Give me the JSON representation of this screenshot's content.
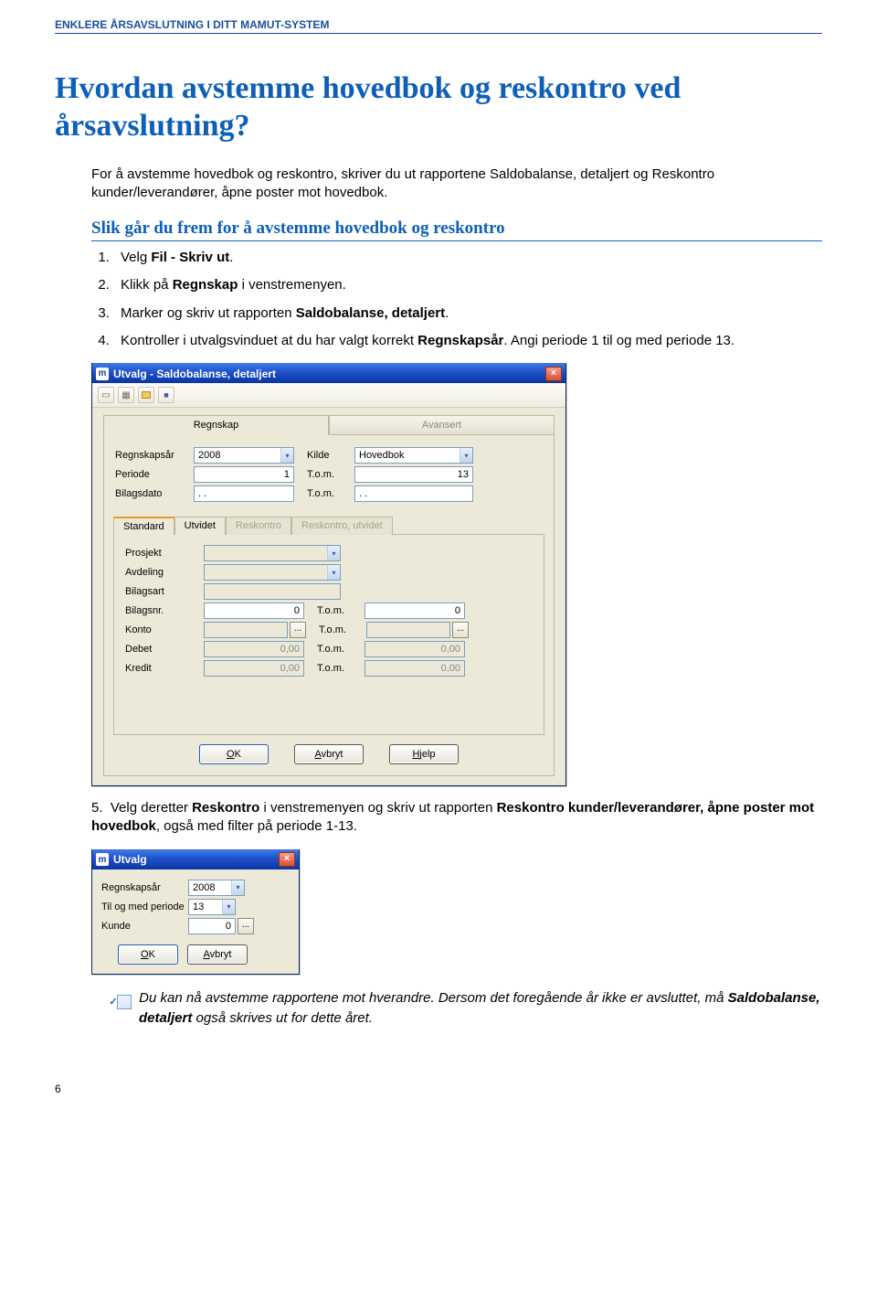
{
  "doc_header": "ENKLERE ÅRSAVSLUTNING I DITT MAMUT-SYSTEM",
  "h1": "Hvordan avstemme hovedbok og reskontro ved årsavslutning?",
  "intro": "For å avstemme hovedbok og reskontro, skriver du ut rapportene Saldobalanse, detaljert og Reskontro kunder/leverandører, åpne poster mot hovedbok.",
  "h2": "Slik går du frem for å avstemme hovedbok og reskontro",
  "steps": {
    "s1a": "Velg ",
    "s1b": "Fil - Skriv ut",
    "s1c": ".",
    "s2a": "Klikk på ",
    "s2b": "Regnskap",
    "s2c": " i venstremenyen.",
    "s3a": "Marker og skriv ut rapporten ",
    "s3b": "Saldobalanse, detaljert",
    "s3c": ".",
    "s4a": "Kontroller i utvalgsvinduet at du har valgt korrekt ",
    "s4b": "Regnskapsår",
    "s4c": ". Angi periode 1 til og med periode 13."
  },
  "step5": {
    "num": "5.",
    "a": "Velg deretter ",
    "b": "Reskontro",
    "c": " i venstremenyen og skriv ut rapporten ",
    "d": "Reskontro kunder/leverandører, åpne poster mot hovedbok",
    "e": ", også med filter på periode 1-13."
  },
  "note": {
    "icon": "✓",
    "a": " Du kan nå avstemme rapportene mot hverandre. Dersom det foregående år ikke er avsluttet, må ",
    "b": "Saldobalanse, detaljert",
    "c": " også skrives ut for dette året."
  },
  "pagenum": "6",
  "dlg1": {
    "title": "Utvalg - Saldobalanse, detaljert",
    "tabs_main": {
      "regnskap": "Regnskap",
      "avansert": "Avansert"
    },
    "fields": {
      "regnskapsar_lbl": "Regnskapsår",
      "regnskapsar_val": "2008",
      "periode_lbl": "Periode",
      "periode_val": "1",
      "bilagsdato_lbl": "Bilagsdato",
      "bilagsdato_val": ". .",
      "kilde_lbl": "Kilde",
      "kilde_val": "Hovedbok",
      "tom_lbl": "T.o.m.",
      "tom_periode": "13",
      "tom_dato": ". ."
    },
    "subtabs": {
      "standard": "Standard",
      "utvidet": "Utvidet",
      "reskontro": "Reskontro",
      "reskontro_utv": "Reskontro, utvidet"
    },
    "sub": {
      "prosjekt": "Prosjekt",
      "avdeling": "Avdeling",
      "bilagsart": "Bilagsart",
      "bilagsnr": "Bilagsnr.",
      "bilagsnr_val": "0",
      "bilagsnr_tom": "0",
      "konto": "Konto",
      "debet": "Debet",
      "debet_val": "0,00",
      "debet_tom": "0,00",
      "kredit": "Kredit",
      "kredit_val": "0,00",
      "kredit_tom": "0,00",
      "tom": "T.o.m."
    },
    "buttons": {
      "ok_u": "O",
      "ok_rest": "K",
      "avbryt_u": "A",
      "avbryt_rest": "vbryt",
      "hjelp_u": "H",
      "hjelp_rest": "jelp"
    }
  },
  "dlg2": {
    "title": "Utvalg",
    "fields": {
      "regnskapsar_lbl": "Regnskapsår",
      "regnskapsar_val": "2008",
      "tom_periode_lbl": "Til og med periode",
      "tom_periode_val": "13",
      "kunde_lbl": "Kunde",
      "kunde_val": "0"
    },
    "buttons": {
      "ok_u": "O",
      "ok_rest": "K",
      "avbryt_u": "A",
      "avbryt_rest": "vbryt"
    }
  }
}
